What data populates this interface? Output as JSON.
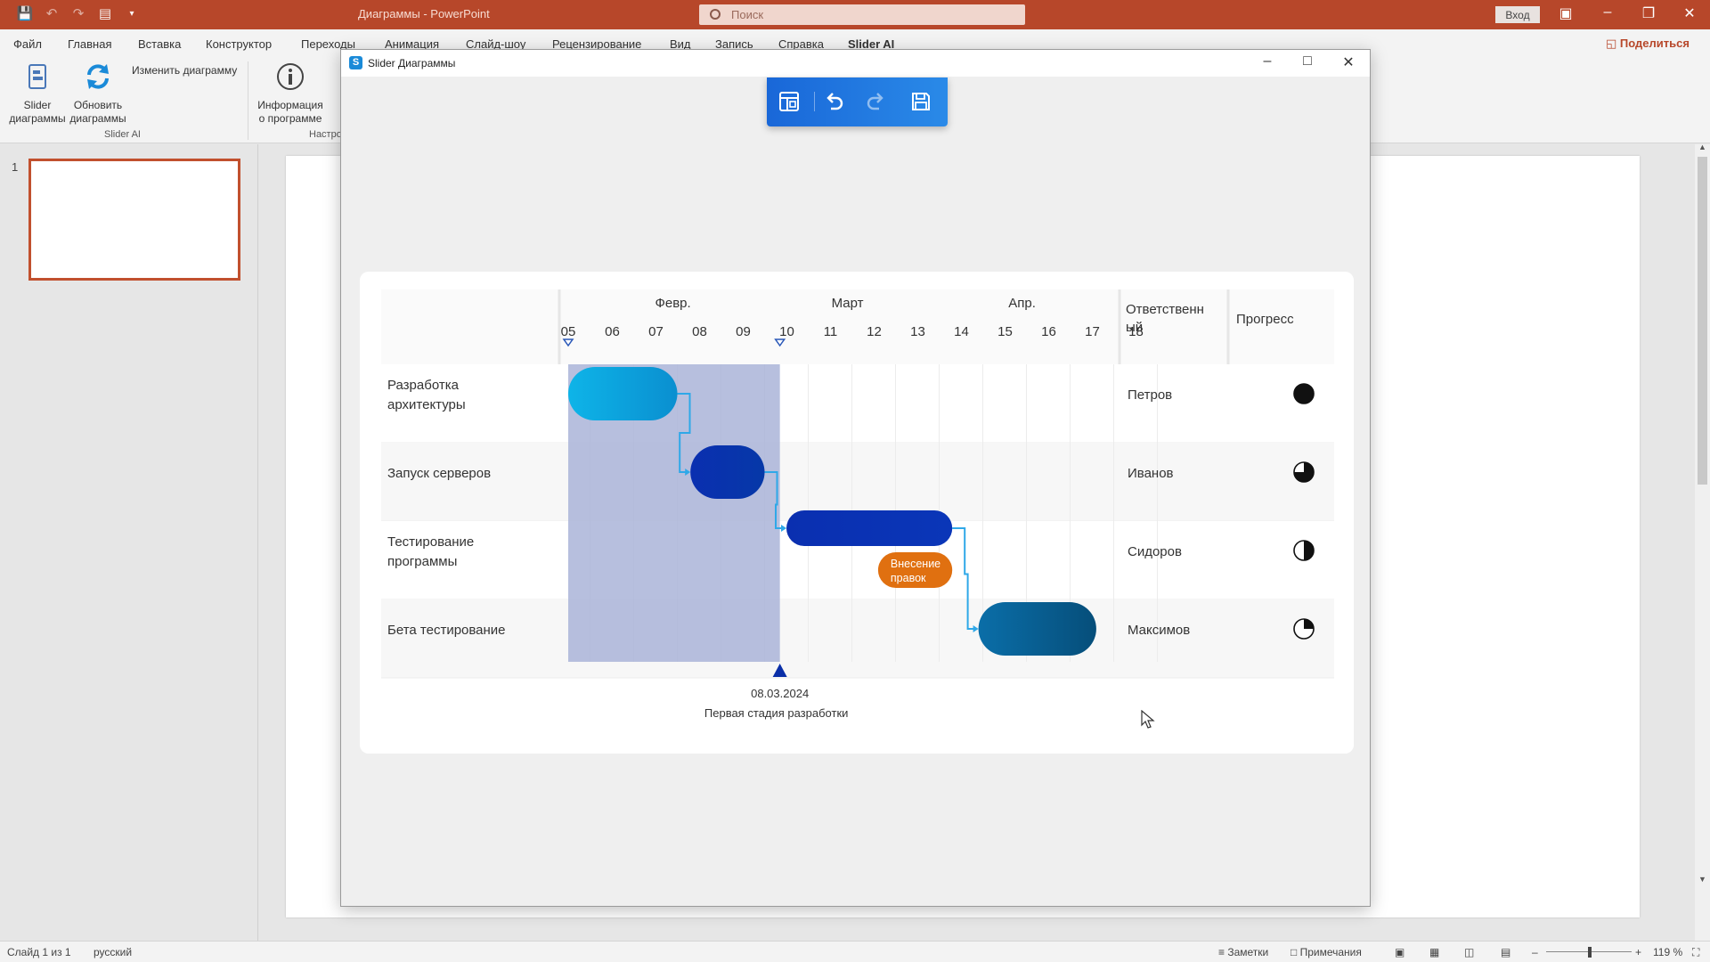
{
  "app": {
    "title": "Диаграммы - PowerPoint",
    "search_placeholder": "Поиск",
    "signin_label": "Вход",
    "share_label": "Поделиться"
  },
  "menu": [
    "Файл",
    "Главная",
    "Вставка",
    "Конструктор",
    "Переходы",
    "Анимация",
    "Слайд-шоу",
    "Рецензирование",
    "Вид",
    "Запись",
    "Справка",
    "Slider AI"
  ],
  "ribbon": {
    "slider_btn": [
      "Slider",
      "диаграммы"
    ],
    "refresh_btn": [
      "Обновить",
      "диаграммы"
    ],
    "edit_btn": "Изменить диаграмму",
    "info_btn": [
      "Информация",
      "о программе"
    ],
    "group_label": "Slider AI",
    "group_label_2": "Настро"
  },
  "slides": {
    "thumb_number": "1"
  },
  "status": {
    "slide_counter": "Слайд 1 из 1",
    "language": "русский",
    "notes": "Заметки",
    "comments": "Примечания",
    "zoom": "119 %"
  },
  "dialog": {
    "title": "Slider Диаграммы"
  },
  "chart_data": {
    "type": "gantt",
    "months": [
      {
        "label": "Февр.",
        "under_day_index": 2
      },
      {
        "label": "Март",
        "under_day_index": 6
      },
      {
        "label": "Апр.",
        "under_day_index": 10
      }
    ],
    "days": [
      "05",
      "06",
      "07",
      "08",
      "09",
      "10",
      "11",
      "12",
      "13",
      "14",
      "15",
      "16",
      "17",
      "18"
    ],
    "columns": {
      "responsible": [
        "Ответственн",
        "ый"
      ],
      "progress": "Прогресс"
    },
    "tasks": [
      {
        "name": [
          "Разработка",
          "архитектуры"
        ],
        "start": 0,
        "end": 2.5,
        "color_from": "#0eb4e8",
        "color_to": "#0a8fd0",
        "responsible": "Петров",
        "progress": 1.0
      },
      {
        "name": [
          "Запуск серверов"
        ],
        "start": 2.8,
        "end": 4.5,
        "color_from": "#0a2fb0",
        "color_to": "#0638a8",
        "responsible": "Иванов",
        "progress": 0.75
      },
      {
        "name": [
          "Тестирование",
          "программы"
        ],
        "start": 5.0,
        "end": 8.8,
        "color_from": "#0a2fb0",
        "color_to": "#0a36b8",
        "responsible": "Сидоров",
        "progress": 0.5
      },
      {
        "name": [
          "Бета тестирование"
        ],
        "start": 9.4,
        "end": 12.1,
        "color_from": "#0a6ea8",
        "color_to": "#064e7a",
        "responsible": "Максимов",
        "progress": 0.25
      }
    ],
    "subtask": {
      "label": [
        "Внесение",
        "правок"
      ],
      "row": 2,
      "start": 7.1,
      "end": 8.8,
      "color": "#e07010"
    },
    "highlight_range": [
      0,
      4.85
    ],
    "milestone": {
      "position": 4.85,
      "date": "08.03.2024",
      "label": "Первая стадия разработки"
    },
    "colors": {
      "highlight": "#aab4d8",
      "connector": "#2fa8e8",
      "milestone": "#0a2fa8"
    }
  }
}
